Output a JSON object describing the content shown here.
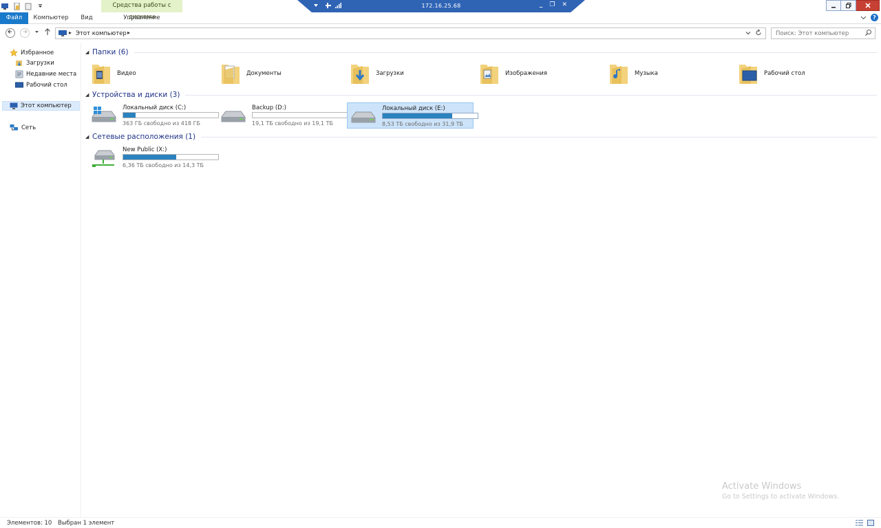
{
  "ribbon": {
    "contextual_tab": "Средства работы с дисками",
    "tabs": {
      "file": "Файл",
      "computer": "Компьютер",
      "view": "Вид",
      "manage": "Управление"
    }
  },
  "rdp": {
    "ip": "172.16.25.68",
    "minimize": "_",
    "restore": "❐",
    "close": "✕"
  },
  "address": {
    "crumb": "Этот компьютер"
  },
  "search": {
    "placeholder": "Поиск: Этот компьютер"
  },
  "nav": {
    "favorites": "Избранное",
    "downloads": "Загрузки",
    "recent": "Недавние места",
    "desktop": "Рабочий стол",
    "this_pc": "Этот компьютер",
    "network": "Сеть"
  },
  "groups": {
    "folders": "Папки (6)",
    "devices": "Устройства и диски (3)",
    "network": "Сетевые расположения (1)"
  },
  "folders": [
    "Видео",
    "Документы",
    "Загрузки",
    "Изображения",
    "Музыка",
    "Рабочий стол"
  ],
  "drives": [
    {
      "name": "Локальный диск (C:)",
      "free": "363 ГБ свободно из 418 ГБ",
      "used_pct": 13
    },
    {
      "name": "Backup (D:)",
      "free": "19,1 ТБ свободно из 19,1 ТБ",
      "used_pct": 0
    },
    {
      "name": "Локальный диск (E:)",
      "free": "8,53 ТБ свободно из 31,9 ТБ",
      "used_pct": 73
    }
  ],
  "network_locations": [
    {
      "name": "New Public (X:)",
      "free": "6,36 ТБ свободно из 14,3 ТБ",
      "used_pct": 56
    }
  ],
  "watermark": {
    "line1": "Activate Windows",
    "line2": "Go to Settings to activate Windows."
  },
  "status": {
    "items": "Элементов: 10",
    "selected": "Выбран 1 элемент"
  },
  "colors": {
    "accent": "#1979ca",
    "selection": "#cce3f9",
    "usage_bar": "#2a82be"
  }
}
